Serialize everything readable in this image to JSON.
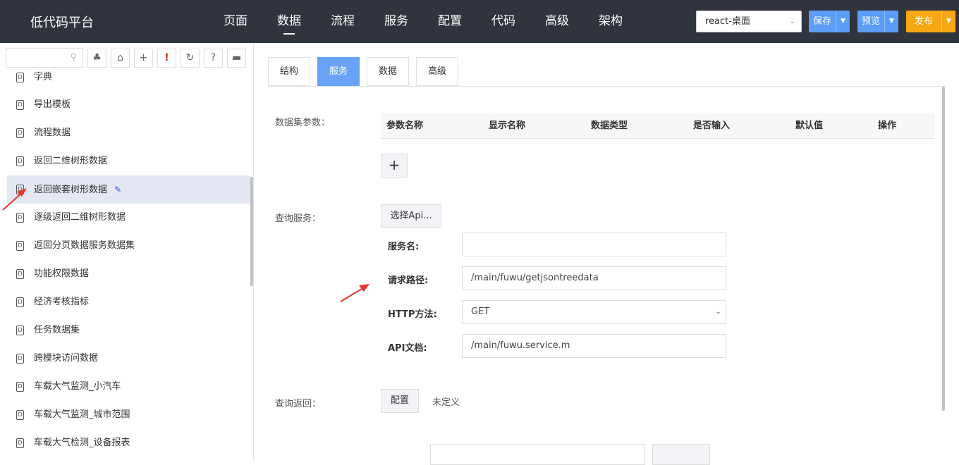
{
  "app": {
    "title": "低代码平台",
    "nav": [
      "页面",
      "数据",
      "流程",
      "服务",
      "配置",
      "代码",
      "高级",
      "架构"
    ],
    "nav_active": 1,
    "project_select": "react-桌面",
    "save_label": "保存",
    "preview_label": "预览",
    "publish_label": "发布"
  },
  "sidebar": {
    "toolbar_icons": [
      "tree-icon",
      "tag-icon",
      "plus-icon",
      "exclamation-icon",
      "refresh-icon",
      "help-icon",
      "comment-icon"
    ],
    "items": [
      "字典",
      "导出模板",
      "流程数据",
      "返回二维树形数据",
      "返回嵌套树形数据",
      "逐级返回二维树形数据",
      "返回分页数据服务数据集",
      "功能权限数据",
      "经济考核指标",
      "任务数据集",
      "跨模块访问数据",
      "车载大气监测_小汽车",
      "车载大气监测_城市范围",
      "车载大气检测_设备报表"
    ],
    "selected_index": 4,
    "doc_icon_letter": "D"
  },
  "main": {
    "tabs": [
      "结构",
      "服务",
      "数据",
      "高级"
    ],
    "active_tab": 1,
    "dataset_params_label": "数据集参数：",
    "param_columns": [
      "参数名称",
      "显示名称",
      "数据类型",
      "是否输入",
      "默认值",
      "操作"
    ],
    "add_label": "+",
    "query_service_label": "查询服务：",
    "pick_api_label": "选择Api...",
    "form": {
      "service_name_label": "服务名:",
      "service_name_value": "",
      "request_path_label": "请求路径:",
      "request_path_value": "/main/fuwu/getjsontreedata",
      "http_method_label": "HTTP方法:",
      "http_method_value": "GET",
      "api_doc_label": "API文档:",
      "api_doc_value": "/main/fuwu.service.m"
    },
    "query_return_label": "查询返回：",
    "config_label": "配置",
    "undefined_label": "未定义"
  },
  "colors": {
    "topbar": "#2f343d",
    "accent_blue": "#5b9df7",
    "tab_active": "#6aa3f5",
    "publish_orange": "#f7a614",
    "selected_row": "#e3e8f3",
    "annotation_arrow": "#e8352b"
  }
}
